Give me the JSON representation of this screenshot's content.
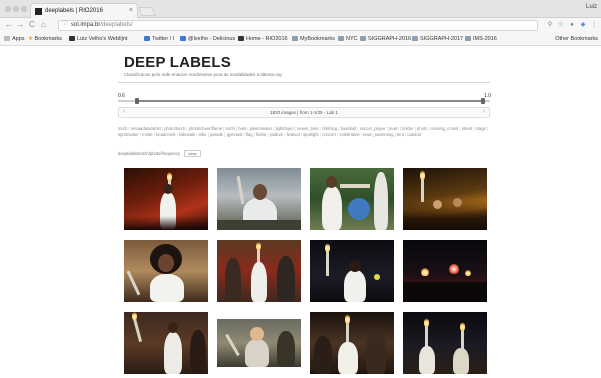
{
  "browser": {
    "tab_title": "deeplabels | RIO2016",
    "tab_close": "×",
    "user_label": "Luiz",
    "nav": {
      "back": "←",
      "forward": "→",
      "reload": "C",
      "home": "⌂"
    },
    "address": {
      "host": "sol.impa.br",
      "path": "/deeplabels/"
    },
    "bookmarks": [
      {
        "label": "Apps",
        "icon": "apps-icon"
      },
      {
        "label": "Bookmarks",
        "icon": "star-icon"
      },
      {
        "label": "Luiz Velho's Weblíjnt",
        "icon": "page-icon"
      },
      {
        "label": "Twitter / I",
        "icon": "twitter-icon"
      },
      {
        "label": "@lvelho - Delicious",
        "icon": "delicious-icon"
      },
      {
        "label": "Home - RIO2016",
        "icon": "page-icon"
      },
      {
        "label": "MyBookmarks",
        "icon": "folder-icon"
      },
      {
        "label": "NYC",
        "icon": "folder-icon"
      },
      {
        "label": "SIGGRAPH-2016",
        "icon": "folder-icon"
      },
      {
        "label": "SIGGRAPH-2017",
        "icon": "folder-icon"
      },
      {
        "label": "IMS-2016",
        "icon": "folder-icon"
      }
    ],
    "other_bookmarks": "Other Bookmarks"
  },
  "page": {
    "title": "DEEP LABELS",
    "subtitle": "Classificacao pelo rede.Imacion rendimiento pura as modalidades a tittenta.org",
    "slider": {
      "min_label": "0.6",
      "max_label": "1.0",
      "low": 0.05,
      "high": 0.98
    },
    "pager": {
      "text": "1820 images | from 1-1/25 - Lab 1",
      "prev": "‹",
      "next": "›"
    },
    "tags": [
      "torch",
      "metaadata/artist",
      "photo/torch",
      "photo/cheer/flame",
      "torch",
      "bats",
      "plasm/water",
      "light/tojeo",
      "newer_toss",
      "climbing",
      "baseball",
      "soccer_player",
      "team",
      "holder",
      "photo",
      "running_crowd",
      "street",
      "stage",
      "sport/water",
      "mode",
      "headcrook",
      "sidewalk",
      "tribe",
      "parade",
      "gymnast",
      "flag",
      "fiesta",
      "podium",
      "festival",
      "spotlight",
      "concert",
      "celebration",
      "team_swimming",
      "tent",
      "outdoor"
    ],
    "search_label": "deeplabels/torch/photo/frequency",
    "clear_label": "clear"
  }
}
